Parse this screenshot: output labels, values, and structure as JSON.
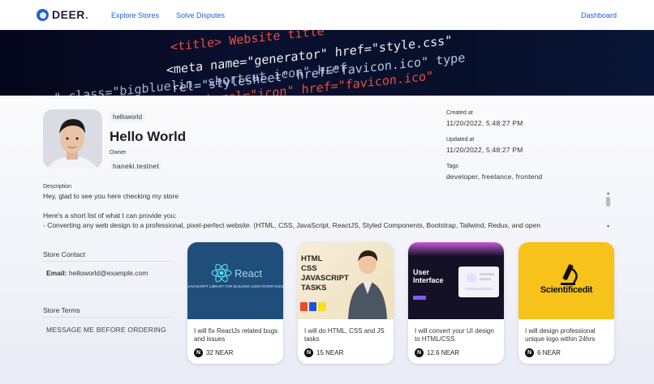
{
  "nav": {
    "logo_text": "DEER",
    "logo_dot": ".",
    "links": [
      "Explore Stores",
      "Solve Disputes"
    ],
    "dashboard": "Dashboard"
  },
  "banner": {
    "code_lines": [
      "<title> Website title",
      "<meta name=\"generator\" href=\"style.css\"",
      "rel=\"stylesheet\" href=\"favicon.ico\" type",
      "<link rel=\"icon\" href=\"favicon.ico\"",
      "maps\" class=\"bigbluelin  shortcut icon\" href"
    ]
  },
  "store": {
    "handle": "helloworld",
    "name": "Hello World",
    "owner_label": "Owner",
    "owner": "haneki.testnet",
    "created_label": "Created at",
    "created": "11/20/2022, 5:48:27 PM",
    "updated_label": "Updated at",
    "updated": "11/20/2022, 5:48:27 PM",
    "tags_label": "Tags",
    "tags": "developer, freelance, frontend",
    "description_label": "Description",
    "description": "Hey, glad to see you here checking my store\n\nHere's a short list of what I can provide you:\n- Converting any web design to a professional, pixel-perfect website. (HTML, CSS, JavaScript, ReactJS, Styled Components, Bootstrap, Tailwind, Redux, and open"
  },
  "contact": {
    "title": "Store Contact",
    "email_label": "Email:",
    "email": "helloworld@example.com"
  },
  "terms": {
    "title": "Store Terms",
    "text": "MESSAGE ME BEFORE ORDERING"
  },
  "cards": [
    {
      "title": "I will fix ReactJs related bugs and issues",
      "price": "32 NEAR",
      "img_text": "React",
      "img_sub": "JAVASCRIPT LIBRARY FOR BUILDING USER INTERFACES"
    },
    {
      "title": "I will do HTML, CSS and JS tasks",
      "price": "15 NEAR",
      "img_text": "HTML\nCSS\nJAVASCRIPT\nTASKS"
    },
    {
      "title": "I will convert your UI design to HTML/CSS",
      "price": "12.6 NEAR",
      "img_text": "User\nInterface"
    },
    {
      "title": "I will design professional unique logo within 24hrs",
      "price": "6 NEAR",
      "img_text": "Scientificedit"
    }
  ],
  "near_symbol": "N",
  "colors": {
    "accent": "#1e5fd6",
    "react_bg": "#1f4e7a",
    "logo_card_bg": "#f7c21a",
    "ui_card_bg": "#141126"
  }
}
